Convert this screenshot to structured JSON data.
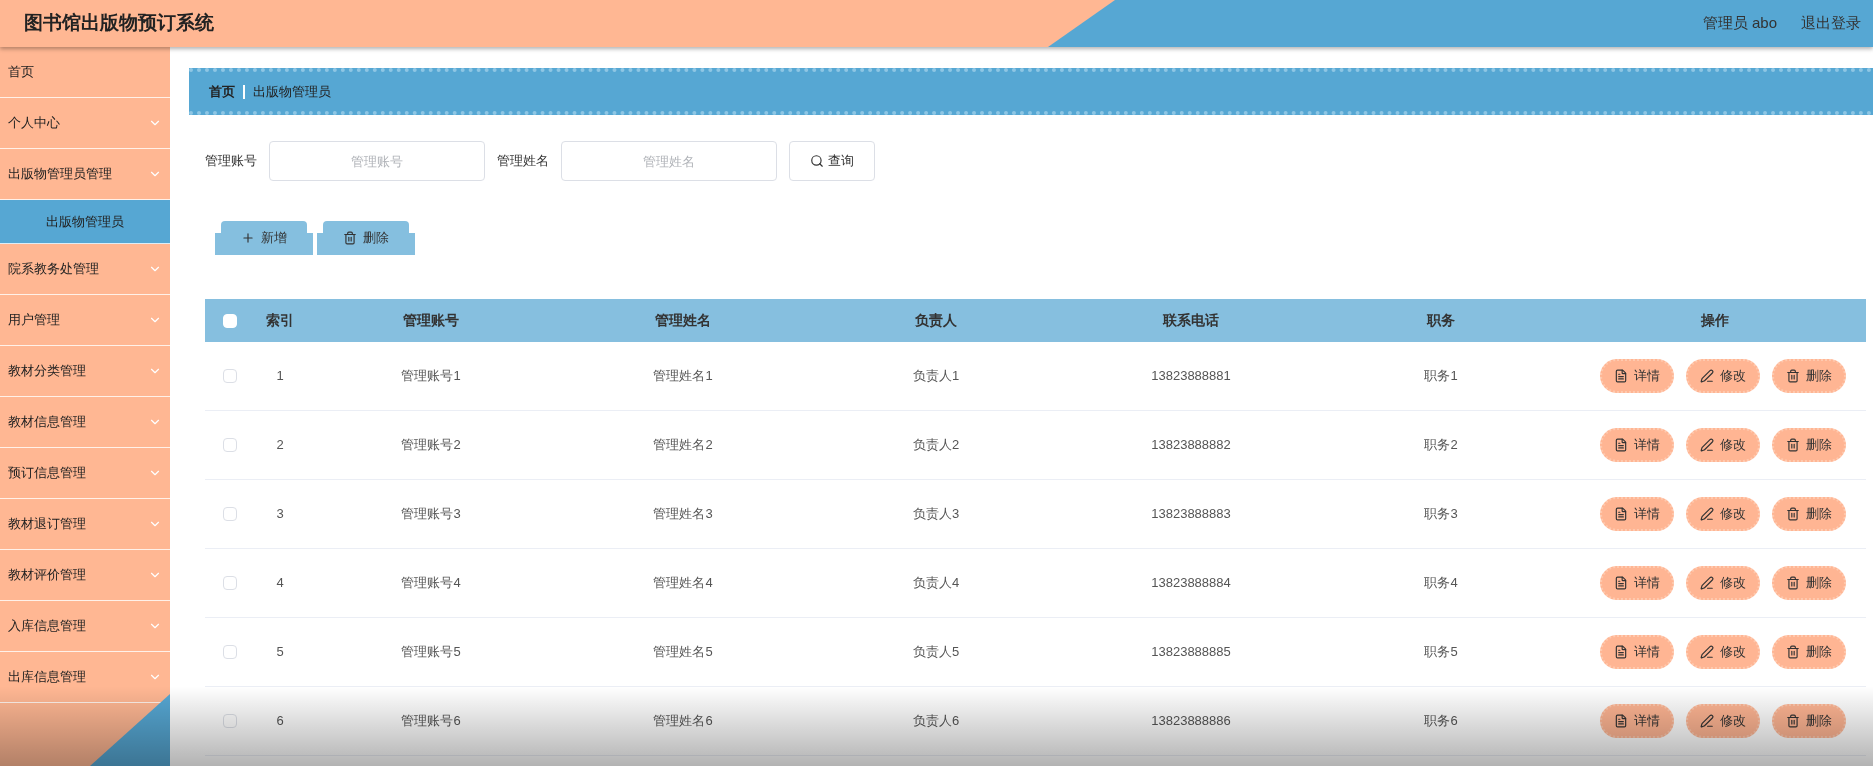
{
  "header": {
    "title": "图书馆出版物预订系统",
    "user": "管理员 abo",
    "logout": "退出登录"
  },
  "sidebar": {
    "items": [
      {
        "kind": "link",
        "label": "首页"
      },
      {
        "kind": "group",
        "label": "个人中心"
      },
      {
        "kind": "group",
        "label": "出版物管理员管理",
        "children": [
          {
            "label": "出版物管理员",
            "selected": true
          }
        ]
      },
      {
        "kind": "group",
        "label": "院系教务处管理"
      },
      {
        "kind": "group",
        "label": "用户管理"
      },
      {
        "kind": "group",
        "label": "教材分类管理"
      },
      {
        "kind": "group",
        "label": "教材信息管理"
      },
      {
        "kind": "group",
        "label": "预订信息管理"
      },
      {
        "kind": "group",
        "label": "教材退订管理"
      },
      {
        "kind": "group",
        "label": "教材评价管理"
      },
      {
        "kind": "group",
        "label": "入库信息管理"
      },
      {
        "kind": "group",
        "label": "出库信息管理"
      }
    ]
  },
  "breadcrumb": [
    "首页",
    "出版物管理员"
  ],
  "search": {
    "fields": [
      {
        "label": "管理账号",
        "placeholder": "管理账号"
      },
      {
        "label": "管理姓名",
        "placeholder": "管理姓名"
      }
    ],
    "button": "查询"
  },
  "actions": [
    {
      "kind": "add",
      "label": "新增"
    },
    {
      "kind": "delete",
      "label": "删除"
    }
  ],
  "table": {
    "select_all": false,
    "columns": [
      "索引",
      "管理账号",
      "管理姓名",
      "负责人",
      "联系电话",
      "职务",
      "操作"
    ],
    "rows": [
      {
        "selected": false,
        "cells": [
          "1",
          "管理账号1",
          "管理姓名1",
          "负责人1",
          "13823888881",
          "职务1"
        ],
        "actions": [
          {
            "kind": "detail",
            "label": "详情"
          },
          {
            "kind": "edit",
            "label": "修改"
          },
          {
            "kind": "delete",
            "label": "删除"
          }
        ]
      },
      {
        "selected": false,
        "cells": [
          "2",
          "管理账号2",
          "管理姓名2",
          "负责人2",
          "13823888882",
          "职务2"
        ],
        "actions": [
          {
            "kind": "detail",
            "label": "详情"
          },
          {
            "kind": "edit",
            "label": "修改"
          },
          {
            "kind": "delete",
            "label": "删除"
          }
        ]
      },
      {
        "selected": false,
        "cells": [
          "3",
          "管理账号3",
          "管理姓名3",
          "负责人3",
          "13823888883",
          "职务3"
        ],
        "actions": [
          {
            "kind": "detail",
            "label": "详情"
          },
          {
            "kind": "edit",
            "label": "修改"
          },
          {
            "kind": "delete",
            "label": "删除"
          }
        ]
      },
      {
        "selected": false,
        "cells": [
          "4",
          "管理账号4",
          "管理姓名4",
          "负责人4",
          "13823888884",
          "职务4"
        ],
        "actions": [
          {
            "kind": "detail",
            "label": "详情"
          },
          {
            "kind": "edit",
            "label": "修改"
          },
          {
            "kind": "delete",
            "label": "删除"
          }
        ]
      },
      {
        "selected": false,
        "cells": [
          "5",
          "管理账号5",
          "管理姓名5",
          "负责人5",
          "13823888885",
          "职务5"
        ],
        "actions": [
          {
            "kind": "detail",
            "label": "详情"
          },
          {
            "kind": "edit",
            "label": "修改"
          },
          {
            "kind": "delete",
            "label": "删除"
          }
        ]
      },
      {
        "selected": false,
        "cells": [
          "6",
          "管理账号6",
          "管理姓名6",
          "负责人6",
          "13823888886",
          "职务6"
        ],
        "actions": [
          {
            "kind": "detail",
            "label": "详情"
          },
          {
            "kind": "edit",
            "label": "修改"
          },
          {
            "kind": "delete",
            "label": "删除"
          }
        ]
      }
    ]
  }
}
